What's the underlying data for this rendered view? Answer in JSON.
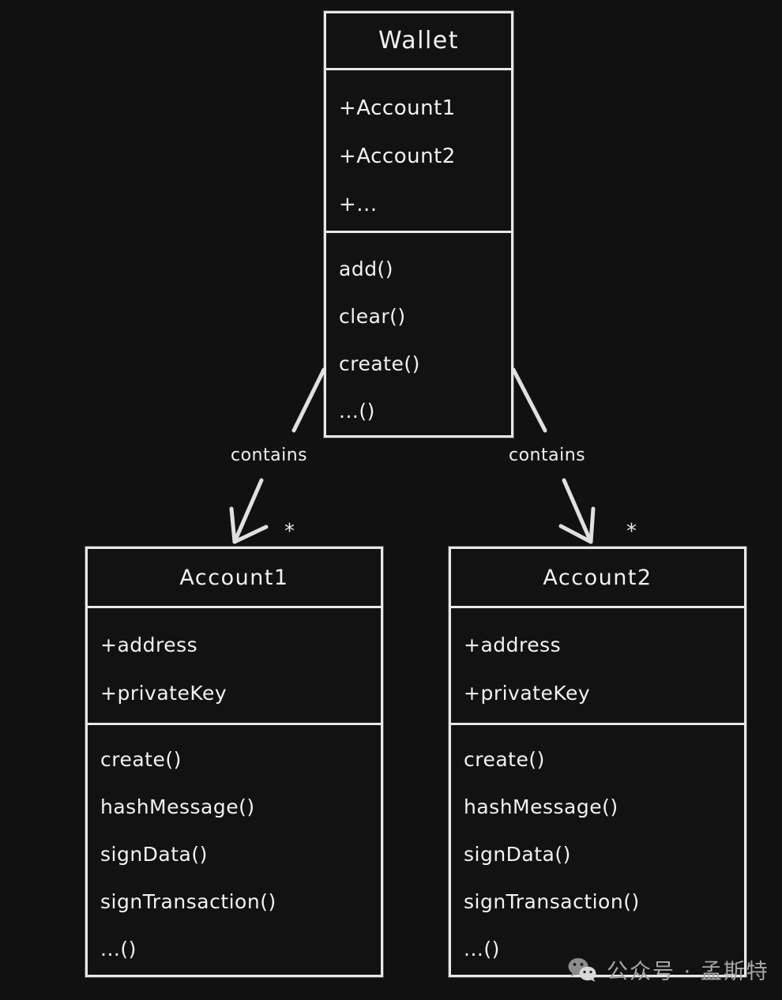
{
  "diagram": {
    "type": "uml-class-diagram",
    "background_color": "#111111",
    "stroke_color": "#e8e8e8",
    "text_color": "#f2f2f2",
    "classes": [
      {
        "id": "wallet",
        "name": "Wallet",
        "attributes": [
          "+Account1",
          "+Account2",
          "+..."
        ],
        "methods": [
          "add()",
          "clear()",
          "create()",
          "...()"
        ]
      },
      {
        "id": "account1",
        "name": "Account1",
        "attributes": [
          "+address",
          "+privateKey"
        ],
        "methods": [
          "create()",
          "hashMessage()",
          "signData()",
          "signTransaction()",
          "...()"
        ]
      },
      {
        "id": "account2",
        "name": "Account2",
        "attributes": [
          "+address",
          "+privateKey"
        ],
        "methods": [
          "create()",
          "hashMessage()",
          "signData()",
          "signTransaction()",
          "...()"
        ]
      }
    ],
    "relationships": [
      {
        "id": "wallet-to-account1",
        "from": "wallet",
        "to": "account1",
        "label": "contains",
        "multiplicity": "*",
        "arrow": "open-arrow"
      },
      {
        "id": "wallet-to-account2",
        "from": "wallet",
        "to": "account2",
        "label": "contains",
        "multiplicity": "*",
        "arrow": "open-arrow"
      }
    ]
  },
  "watermark": {
    "icon": "wechat-logo-icon",
    "text": "公众号 · 孟斯特",
    "color": "#a6a6a6"
  }
}
